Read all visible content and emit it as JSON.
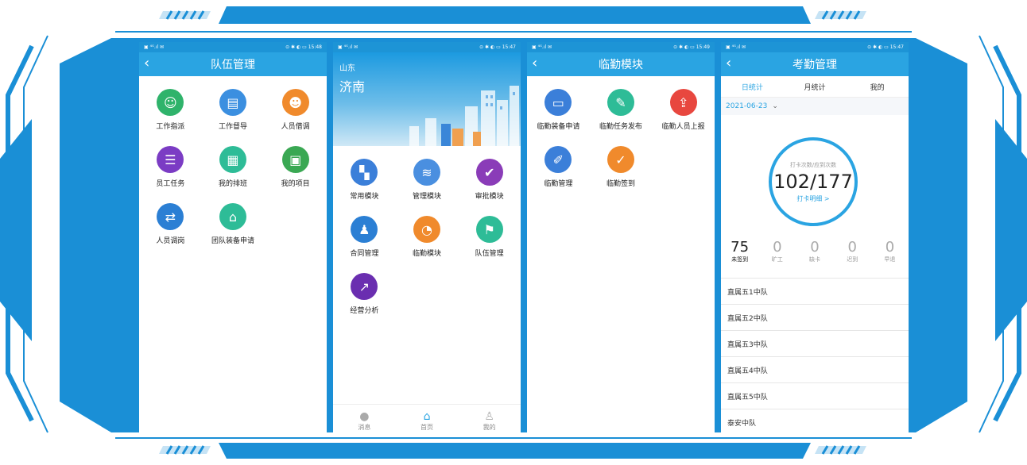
{
  "phone1": {
    "status_left": "▣ ⁴ᴳ.ıl ✉",
    "status_right": "⊙ ✱ ◐ ▭ 15:48",
    "title": "队伍管理",
    "items": [
      {
        "label": "工作指派",
        "icon": "dispatch-icon",
        "color": "#2fb36b"
      },
      {
        "label": "工作督导",
        "icon": "clipboard-icon",
        "color": "#3b8fe0"
      },
      {
        "label": "人员借调",
        "icon": "officer-icon",
        "color": "#f08a2c"
      },
      {
        "label": "员工任务",
        "icon": "task-list-icon",
        "color": "#7b3cc4"
      },
      {
        "label": "我的排班",
        "icon": "schedule-icon",
        "color": "#2ebc97"
      },
      {
        "label": "我的项目",
        "icon": "project-icon",
        "color": "#3aa853"
      },
      {
        "label": "人员调岗",
        "icon": "transfer-icon",
        "color": "#2b7fd4"
      },
      {
        "label": "团队装备申请",
        "icon": "warehouse-icon",
        "color": "#2ebc97"
      }
    ]
  },
  "phone2": {
    "status_left": "▣ ⁴ᴳ.ıl ✉",
    "status_right": "⊙ ✱ ◐ ▭ 15:47",
    "province": "山东",
    "city": "济南",
    "items": [
      {
        "label": "常用模块",
        "icon": "grid-icon",
        "color": "#3b7fd9"
      },
      {
        "label": "管理模块",
        "icon": "layers-icon",
        "color": "#4a8fe0"
      },
      {
        "label": "审批模块",
        "icon": "approve-icon",
        "color": "#8a3cb8"
      },
      {
        "label": "合同管理",
        "icon": "stamp-icon",
        "color": "#2b7fd4"
      },
      {
        "label": "临勤模块",
        "icon": "clock-icon",
        "color": "#f08a2c"
      },
      {
        "label": "队伍管理",
        "icon": "flag-icon",
        "color": "#2ebc97"
      },
      {
        "label": "经营分析",
        "icon": "chart-icon",
        "color": "#6a2eb0"
      }
    ],
    "tabs": [
      {
        "label": "消息",
        "icon": "message-icon"
      },
      {
        "label": "首页",
        "icon": "home-icon"
      },
      {
        "label": "我的",
        "icon": "user-icon"
      }
    ]
  },
  "phone3": {
    "status_left": "▣ ⁴ᴳ.ıl ✉",
    "status_right": "⊙ ✱ ◐ ▭ 15:49",
    "title": "临勤模块",
    "items": [
      {
        "label": "临勤装备申请",
        "icon": "id-card-icon",
        "color": "#3b7fd9"
      },
      {
        "label": "临勤任务发布",
        "icon": "edit-icon",
        "color": "#2ebc97"
      },
      {
        "label": "临勤人员上报",
        "icon": "upload-icon",
        "color": "#e8473f"
      },
      {
        "label": "临勤管理",
        "icon": "manage-icon",
        "color": "#3b7fd9"
      },
      {
        "label": "临勤签到",
        "icon": "checkin-icon",
        "color": "#f08a2c"
      }
    ]
  },
  "phone4": {
    "status_left": "▣ ⁴ᴳ.ıl ✉",
    "status_right": "⊙ ✱ ◐ ▭ 15:47",
    "title": "考勤管理",
    "tabs": [
      "日统计",
      "月统计",
      "我的"
    ],
    "date": "2021-06-23",
    "ring_caption": "打卡次数/应到次数",
    "ring_value": "102/177",
    "ring_link": "打卡明细 >",
    "stats": [
      {
        "value": "75",
        "label": "未签到"
      },
      {
        "value": "0",
        "label": "旷工"
      },
      {
        "value": "0",
        "label": "缺卡"
      },
      {
        "value": "0",
        "label": "迟到"
      },
      {
        "value": "0",
        "label": "早退"
      }
    ],
    "teams": [
      "直属五1中队",
      "直属五2中队",
      "直属五3中队",
      "直属五4中队",
      "直属五5中队",
      "泰安中队"
    ]
  },
  "colors": {
    "primary": "#2aa4e2",
    "frame": "#1a8fd6"
  }
}
